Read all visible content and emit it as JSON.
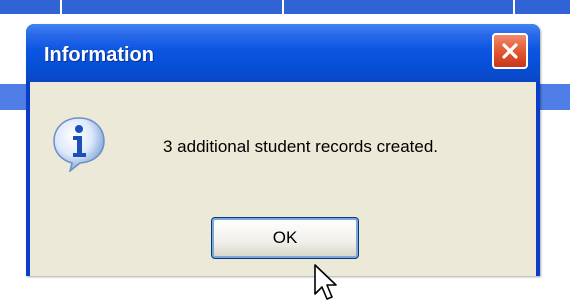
{
  "dialog": {
    "title": "Information",
    "message": "3 additional student records created.",
    "ok_label": "OK",
    "close_icon": "close-icon",
    "message_icon": "information-icon"
  },
  "colors": {
    "titlebar": "#0650d8",
    "close_button": "#e2532f",
    "dialog_background": "#ece9d8",
    "background_app_bar": "#2f63d6"
  }
}
